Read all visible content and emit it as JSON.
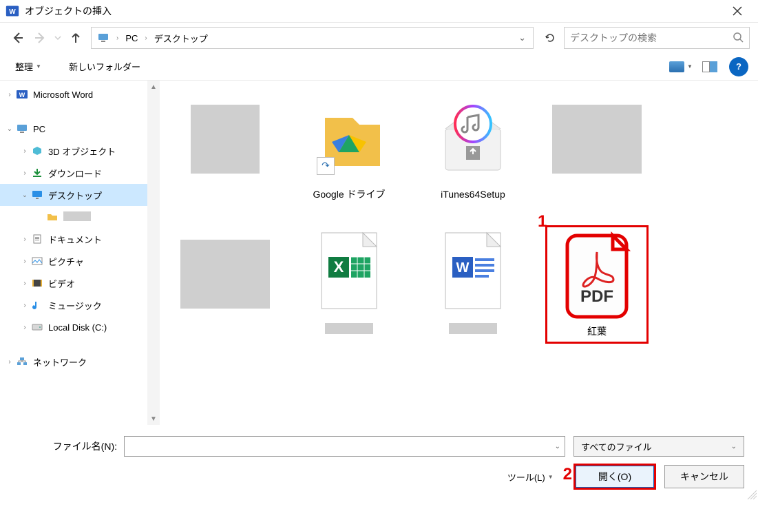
{
  "title": "オブジェクトの挿入",
  "breadcrumb": {
    "root_icon": "pc",
    "items": [
      "PC",
      "デスクトップ"
    ]
  },
  "search": {
    "placeholder": "デスクトップの検索"
  },
  "toolbar": {
    "organize": "整理",
    "newfolder": "新しいフォルダー"
  },
  "sidebar": [
    {
      "indent": 0,
      "toggle": "›",
      "icon": "word",
      "label": "Microsoft Word"
    },
    {
      "indent": 0,
      "toggle": "⌄",
      "icon": "pc",
      "label": "PC"
    },
    {
      "indent": 1,
      "toggle": "›",
      "icon": "3d",
      "label": "3D オブジェクト"
    },
    {
      "indent": 1,
      "toggle": "›",
      "icon": "download",
      "label": "ダウンロード"
    },
    {
      "indent": 1,
      "toggle": "⌄",
      "icon": "desktop",
      "label": "デスクトップ",
      "selected": true
    },
    {
      "indent": 2,
      "toggle": "",
      "icon": "folder",
      "label": "",
      "blank": true
    },
    {
      "indent": 1,
      "toggle": "›",
      "icon": "doc",
      "label": "ドキュメント"
    },
    {
      "indent": 1,
      "toggle": "›",
      "icon": "pic",
      "label": "ピクチャ"
    },
    {
      "indent": 1,
      "toggle": "›",
      "icon": "video",
      "label": "ビデオ"
    },
    {
      "indent": 1,
      "toggle": "›",
      "icon": "music",
      "label": "ミュージック"
    },
    {
      "indent": 1,
      "toggle": "›",
      "icon": "disk",
      "label": "Local Disk (C:)"
    },
    {
      "indent": 0,
      "toggle": "›",
      "icon": "network",
      "label": "ネットワーク"
    }
  ],
  "files": [
    {
      "type": "image",
      "label": ""
    },
    {
      "type": "gdrive",
      "label": "Google ドライブ",
      "shortcut": true
    },
    {
      "type": "itunes",
      "label": "iTunes64Setup"
    },
    {
      "type": "image-wide",
      "label": ""
    },
    {
      "type": "image-wide",
      "label": ""
    },
    {
      "type": "excel",
      "label": ""
    },
    {
      "type": "word",
      "label": ""
    },
    {
      "type": "pdf",
      "label": "紅葉",
      "selected": true,
      "annotation": "1"
    }
  ],
  "bottom": {
    "filename_label": "ファイル名(N):",
    "filter_label": "すべてのファイル",
    "tools_label": "ツール(L)",
    "open_label": "開く(O)",
    "cancel_label": "キャンセル",
    "open_annotation": "2"
  }
}
